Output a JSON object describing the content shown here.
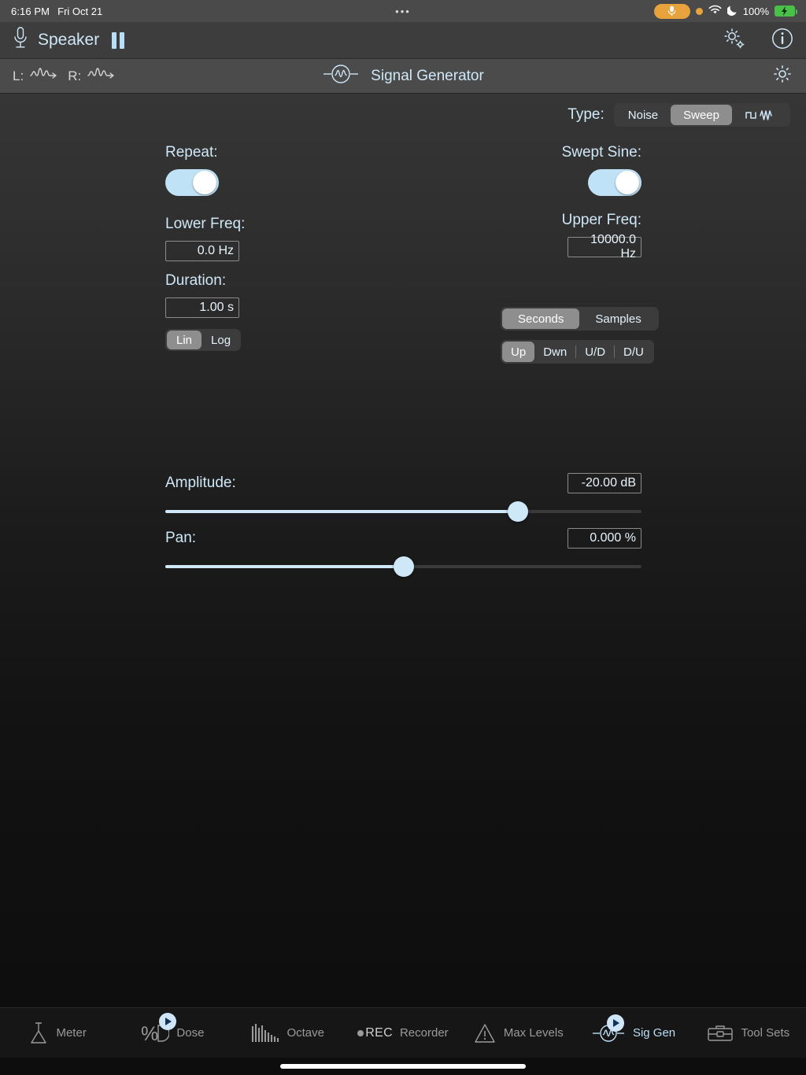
{
  "status_bar": {
    "time": "6:16 PM",
    "date": "Fri Oct 21",
    "dots": "•••",
    "battery_percent": "100%",
    "mic_icon": "microphone-icon",
    "wifi_icon": "wifi-icon",
    "moon_icon": "moon-icon",
    "battery_icon": "battery-charging-icon",
    "accent_orange": "#e8a33d",
    "battery_green": "#49c04a"
  },
  "app_bar": {
    "mic_icon": "microphone-icon",
    "output_label": "Speaker",
    "pause_label": "pause-button",
    "settings_icon": "gears-icon",
    "info_icon": "info-circle-icon"
  },
  "sub_bar": {
    "left_channel_label": "L:",
    "right_channel_label": "R:",
    "title": "Signal Generator",
    "title_icon": "signal-generator-icon",
    "gear_icon": "gear-icon"
  },
  "type_row": {
    "label": "Type:",
    "options": [
      "Noise",
      "Sweep",
      "waveform-icon"
    ],
    "selected": "Sweep"
  },
  "left_column": {
    "repeat_label": "Repeat:",
    "repeat_on": true,
    "lower_freq_label": "Lower Freq:",
    "lower_freq_value": "0.0 Hz",
    "duration_label": "Duration:",
    "duration_value": "1.00 s",
    "scale_options": [
      "Lin",
      "Log"
    ],
    "scale_selected": "Lin"
  },
  "right_column": {
    "swept_sine_label": "Swept Sine:",
    "swept_sine_on": true,
    "upper_freq_label": "Upper Freq:",
    "upper_freq_value": "10000.0 Hz",
    "units_options": [
      "Seconds",
      "Samples"
    ],
    "units_selected": "Seconds",
    "direction_options": [
      "Up",
      "Dwn",
      "U/D",
      "D/U"
    ],
    "direction_selected": "Up"
  },
  "sliders": {
    "amplitude": {
      "label": "Amplitude:",
      "value": "-20.00 dB",
      "percent": 74
    },
    "pan": {
      "label": "Pan:",
      "value": "0.000 %",
      "percent": 50
    },
    "accent": "#cfe8f8"
  },
  "tab_bar": {
    "tabs": [
      {
        "label": "Meter",
        "icon": "meter-cone-icon",
        "badge": false,
        "active": false
      },
      {
        "label": "Dose",
        "icon": "dose-percent-icon",
        "badge": true,
        "active": false
      },
      {
        "label": "Octave",
        "icon": "octave-bars-icon",
        "badge": false,
        "active": false
      },
      {
        "label": "Recorder",
        "icon": "rec-icon",
        "badge": false,
        "active": false,
        "prefix": "REC"
      },
      {
        "label": "Max Levels",
        "icon": "warning-triangle-icon",
        "badge": false,
        "active": false
      },
      {
        "label": "Sig Gen",
        "icon": "signal-generator-icon",
        "badge": true,
        "active": true
      },
      {
        "label": "Tool Sets",
        "icon": "toolbox-icon",
        "badge": false,
        "active": false
      }
    ]
  }
}
